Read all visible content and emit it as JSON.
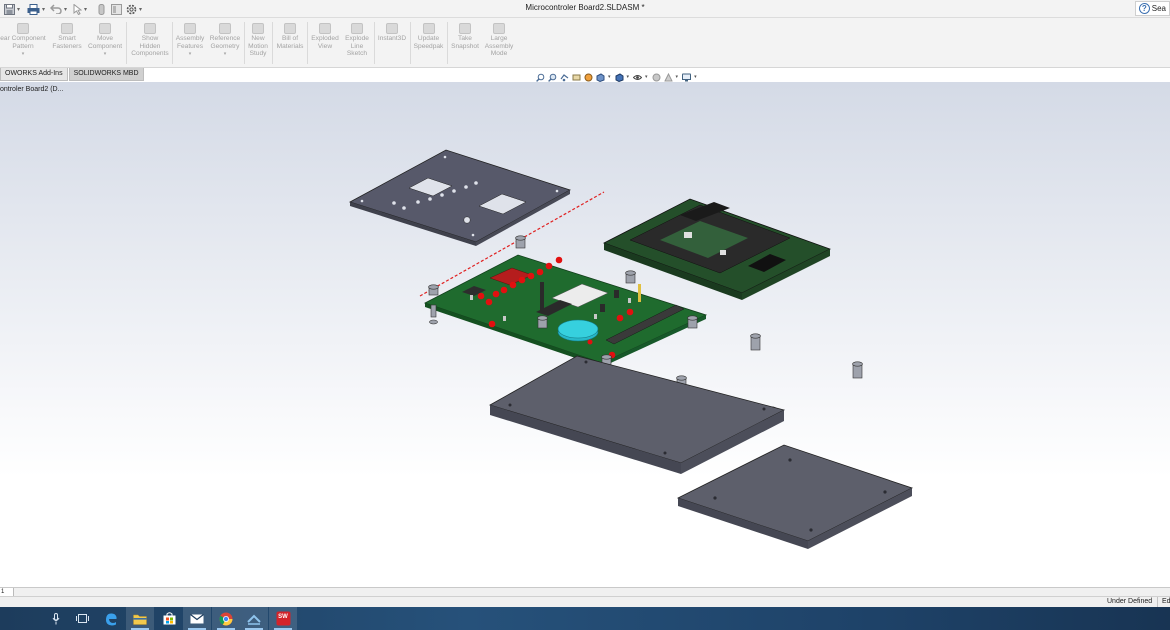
{
  "window": {
    "title": "Microcontroler Board2.SLDASM *"
  },
  "quick_access": {
    "dropdown_glyph": "▾"
  },
  "search": {
    "label": "Sea"
  },
  "ribbon": {
    "buttons": [
      {
        "line1": "ear Component",
        "line2": "Pattern",
        "line3": "",
        "arrow": "▾"
      },
      {
        "line1": "Smart",
        "line2": "Fasteners",
        "line3": "",
        "arrow": ""
      },
      {
        "line1": "Move",
        "line2": "Component",
        "line3": "",
        "arrow": "▾"
      },
      {
        "line1": "Show",
        "line2": "Hidden",
        "line3": "Components",
        "arrow": ""
      },
      {
        "line1": "Assembly",
        "line2": "Features",
        "line3": "",
        "arrow": "▾"
      },
      {
        "line1": "Reference",
        "line2": "Geometry",
        "line3": "",
        "arrow": "▾"
      },
      {
        "line1": "New",
        "line2": "Motion",
        "line3": "Study",
        "arrow": ""
      },
      {
        "line1": "Bill of",
        "line2": "Materials",
        "line3": "",
        "arrow": ""
      },
      {
        "line1": "Exploded",
        "line2": "View",
        "line3": "",
        "arrow": ""
      },
      {
        "line1": "Explode",
        "line2": "Line",
        "line3": "Sketch",
        "arrow": ""
      },
      {
        "line1": "Instant3D",
        "line2": "",
        "line3": "",
        "arrow": ""
      },
      {
        "line1": "Update",
        "line2": "Speedpak",
        "line3": "",
        "arrow": ""
      },
      {
        "line1": "Take",
        "line2": "Snapshot",
        "line3": "",
        "arrow": ""
      },
      {
        "line1": "Large",
        "line2": "Assembly",
        "line3": "Mode",
        "arrow": ""
      }
    ]
  },
  "tabs": [
    {
      "label": "OWORKS Add-Ins"
    },
    {
      "label": "SOLIDWORKS MBD"
    }
  ],
  "tree": {
    "root_label": "ontroler Board2  (D..."
  },
  "sheet": {
    "tab_label": "1"
  },
  "status": {
    "state": "Under Defined",
    "mode": "Ed"
  },
  "colors": {
    "pcb": "#1f6b2e",
    "panel": "#5d5f6b",
    "led": "#e21010",
    "buzzer": "#27b9c9",
    "explode_line": "#e02020"
  },
  "taskbar": {
    "items": [
      {
        "icon": "microphone-icon"
      },
      {
        "icon": "task-view-icon"
      },
      {
        "icon": "edge-icon"
      },
      {
        "icon": "file-explorer-icon"
      },
      {
        "icon": "store-icon"
      },
      {
        "icon": "mail-icon"
      },
      {
        "icon": "chrome-icon"
      },
      {
        "icon": "steam-icon"
      },
      {
        "icon": "solidworks-icon"
      }
    ],
    "solidworks_label": "SW"
  }
}
